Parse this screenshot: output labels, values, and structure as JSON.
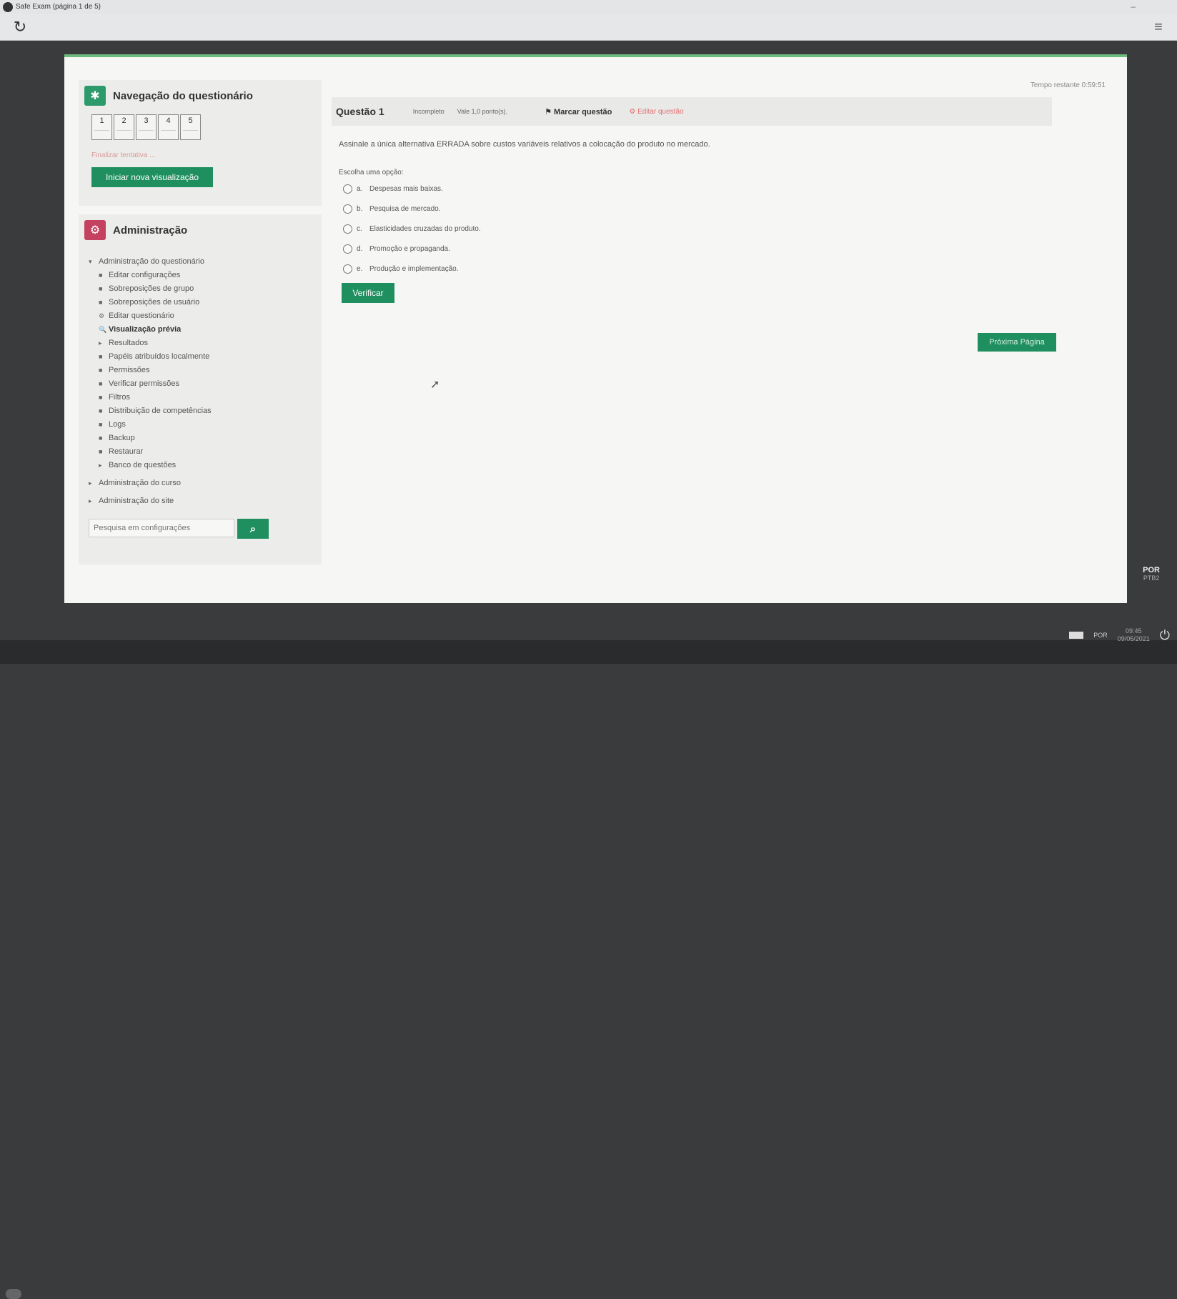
{
  "window": {
    "title": "Safe Exam (página 1 de 5)"
  },
  "nav_block": {
    "title": "Navegação do questionário",
    "questions": [
      "1",
      "2",
      "3",
      "4",
      "5"
    ],
    "finish_link": "Finalizar tentativa ...",
    "new_preview_button": "Iniciar nova visualização"
  },
  "admin_block": {
    "title": "Administração",
    "tree": [
      {
        "label": "Administração do questionário",
        "marker": "▾"
      },
      {
        "label": "Editar configurações",
        "marker": "■"
      },
      {
        "label": "Sobreposições de grupo",
        "marker": "■"
      },
      {
        "label": "Sobreposições de usuário",
        "marker": "■"
      },
      {
        "label": "Editar questionário",
        "marker": "⚙"
      },
      {
        "label": "Visualização prévia",
        "marker": "🔍"
      },
      {
        "label": "Resultados",
        "marker": "▸"
      },
      {
        "label": "Papéis atribuídos localmente",
        "marker": "■"
      },
      {
        "label": "Permissões",
        "marker": "■"
      },
      {
        "label": "Verificar permissões",
        "marker": "■"
      },
      {
        "label": "Filtros",
        "marker": "■"
      },
      {
        "label": "Distribuição de competências",
        "marker": "■"
      },
      {
        "label": "Logs",
        "marker": "■"
      },
      {
        "label": "Backup",
        "marker": "■"
      },
      {
        "label": "Restaurar",
        "marker": "■"
      },
      {
        "label": "Banco de questões",
        "marker": "▸"
      },
      {
        "label": "Administração do curso",
        "marker": "▸"
      },
      {
        "label": "Administração do site",
        "marker": "▸"
      }
    ],
    "search_placeholder": "Pesquisa em configurações"
  },
  "quiz": {
    "timer": "Tempo restante 0:59:51",
    "question_title": "Questão 1",
    "state": "Incompleto",
    "marks": "Vale 1,0 ponto(s).",
    "flag_label": "Marcar questão",
    "edit_label": "Editar questão",
    "text": "Assinale a única alternativa ERRADA sobre custos variáveis relativos a colocação do produto no mercado.",
    "prompt": "Escolha uma opção:",
    "options": [
      {
        "letter": "a.",
        "text": "Despesas mais baixas."
      },
      {
        "letter": "b.",
        "text": "Pesquisa de mercado."
      },
      {
        "letter": "c.",
        "text": "Elasticidades cruzadas do produto."
      },
      {
        "letter": "d.",
        "text": "Promoção e propaganda."
      },
      {
        "letter": "e.",
        "text": "Produção e implementação."
      }
    ],
    "verify_button": "Verificar",
    "next_button": "Próxima Página"
  },
  "system": {
    "lang_code": "POR",
    "lang_sub": "PTB2",
    "tray_lang": "POR",
    "clock_time": "09:45",
    "clock_date": "09/05/2021"
  },
  "icons": {
    "reload": "reload-icon",
    "menu": "hamburger-menu-icon",
    "nav_block": "puzzle-icon",
    "admin_block": "gears-icon",
    "search": "search-icon"
  }
}
